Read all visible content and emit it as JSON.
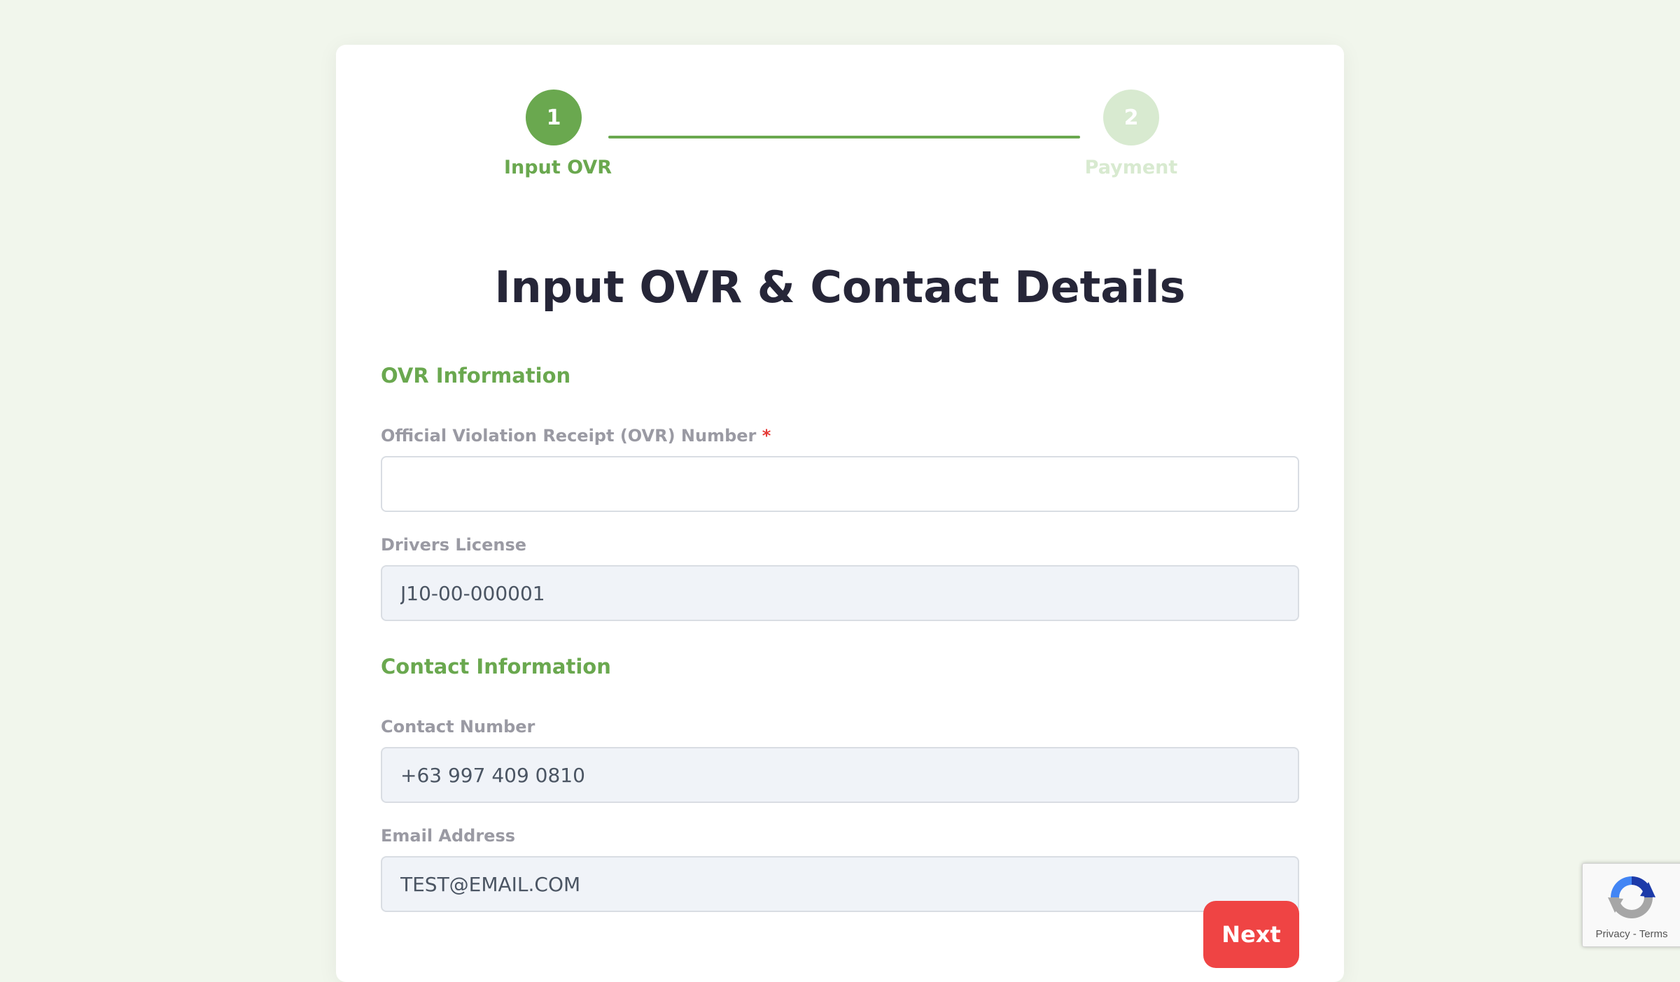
{
  "stepper": {
    "steps": [
      {
        "number": "1",
        "label": "Input OVR",
        "state": "active"
      },
      {
        "number": "2",
        "label": "Payment",
        "state": "inactive"
      }
    ]
  },
  "title": "Input OVR & Contact Details",
  "sections": {
    "ovr": {
      "heading": "OVR Information",
      "ovr_number": {
        "label": "Official Violation Receipt (OVR) Number",
        "required_mark": "*",
        "value": ""
      },
      "drivers_license": {
        "label": "Drivers License",
        "value": "J10-00-000001"
      }
    },
    "contact": {
      "heading": "Contact Information",
      "contact_number": {
        "label": "Contact Number",
        "value": "+63 997 409 0810"
      },
      "email": {
        "label": "Email Address",
        "value": "TEST@EMAIL.COM"
      }
    }
  },
  "actions": {
    "next_label": "Next"
  },
  "recaptcha": {
    "privacy": "Privacy",
    "separator": " - ",
    "terms": "Terms",
    "icon": "recaptcha-icon"
  },
  "colors": {
    "accent": "#6aa84f",
    "accent_light": "#d8ead0",
    "danger": "#ef4444",
    "background": "#f1f6ec",
    "title": "#262638"
  }
}
